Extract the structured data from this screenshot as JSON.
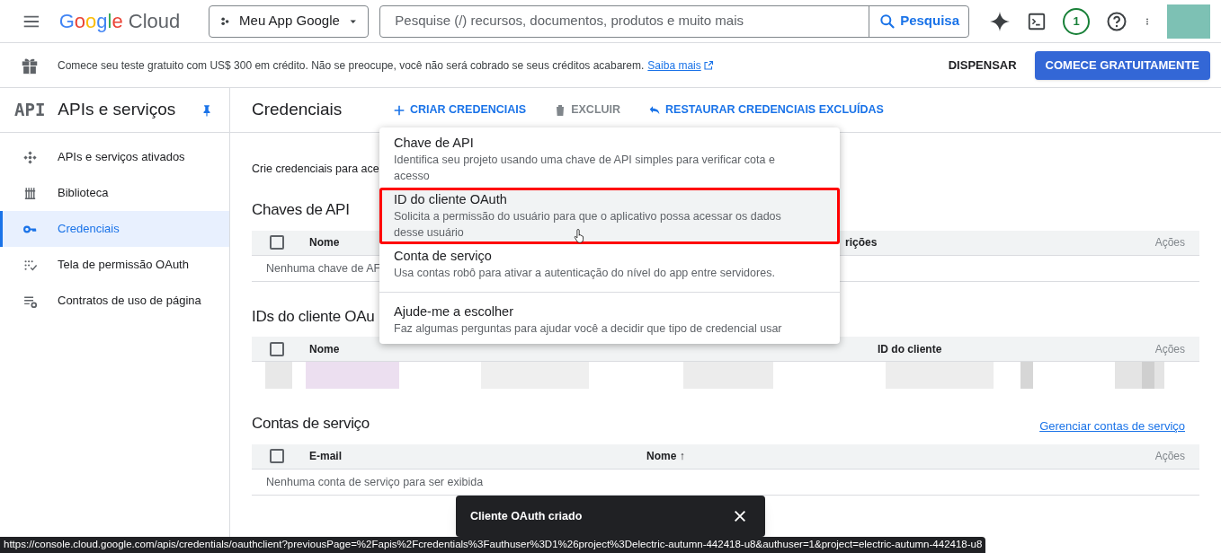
{
  "topbar": {
    "logo": {
      "word": "Google",
      "suffix": "Cloud"
    },
    "project": "Meu App Google",
    "search": {
      "placeholder": "Pesquise (/) recursos, documentos, produtos e muito mais",
      "button": "Pesquisa"
    },
    "notification_count": "1"
  },
  "banner": {
    "text": "Comece seu teste gratuito com US$ 300 em crédito. Não se preocupe, você não será cobrado se seus créditos acabarem.",
    "link": "Saiba mais",
    "dismiss": "DISPENSAR",
    "cta": "COMECE GRATUITAMENTE"
  },
  "sidebar": {
    "badge": "API",
    "title": "APIs e serviços",
    "items": [
      {
        "label": "APIs e serviços ativados",
        "selected": false
      },
      {
        "label": "Biblioteca",
        "selected": false
      },
      {
        "label": "Credenciais",
        "selected": true
      },
      {
        "label": "Tela de permissão OAuth",
        "selected": false
      },
      {
        "label": "Contratos de uso de página",
        "selected": false
      }
    ]
  },
  "toolbar": {
    "title": "Credenciais",
    "actions": [
      {
        "label": "CRIAR CREDENCIAIS",
        "disabled": false
      },
      {
        "label": "EXCLUIR",
        "disabled": true
      },
      {
        "label": "RESTAURAR CREDENCIAIS EXCLUÍDAS",
        "disabled": false
      }
    ]
  },
  "intro": "Crie credenciais para ace",
  "sections": [
    {
      "title": "Chaves de API",
      "checked": false,
      "columns": [
        "Nome",
        "rições",
        "Ações"
      ],
      "empty": "Nenhuma chave de AF"
    },
    {
      "title": "IDs do cliente OAu",
      "checked": false,
      "columns": [
        "Nome",
        "ID do cliente",
        "Ações"
      ],
      "rows": [
        {
          "kind": "picture"
        }
      ]
    },
    {
      "title": "Contas de serviço",
      "checked": false,
      "link": "Gerenciar contas de serviço",
      "columns": [
        "E-mail",
        "Nome ↑",
        "Ações"
      ],
      "empty": "Nenhuma conta de serviço para ser exibida"
    }
  ],
  "menu": {
    "items": [
      {
        "title": "Chave de API",
        "description": "Identifica seu projeto usando uma chave de API simples para verificar cota e acesso",
        "highlighted": false
      },
      {
        "title": "ID do cliente OAuth",
        "description": "Solicita a permissão do usuário para que o aplicativo possa acessar os dados desse usuário",
        "highlighted": true
      },
      {
        "title": "Conta de serviço",
        "description": "Usa contas robô para ativar a autenticação do nível do app entre servidores.",
        "highlighted": false
      },
      {
        "title": "Ajude-me a escolher",
        "description": "Faz algumas perguntas para ajudar você a decidir que tipo de credencial usar",
        "highlighted": false
      }
    ]
  },
  "snackbar": {
    "message": "Cliente OAuth criado"
  },
  "status_url": "https://console.cloud.google.com/apis/credentials/oauthclient?previousPage=%2Fapis%2Fcredentials%3Fauthuser%3D1%26project%3Delectric-autumn-442418-u8&authuser=1&project=electric-autumn-442418-u8"
}
